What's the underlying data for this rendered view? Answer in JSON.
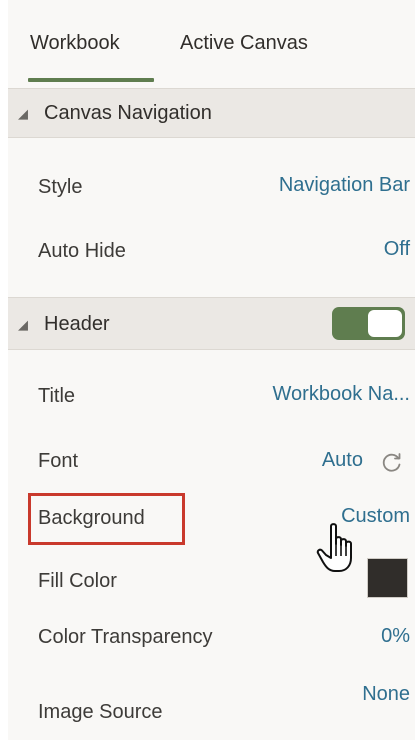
{
  "tabs": [
    {
      "label": "Workbook",
      "active": true
    },
    {
      "label": "Active Canvas",
      "active": false
    }
  ],
  "canvas_navigation": {
    "title": "Canvas Navigation",
    "rows": [
      {
        "label": "Style",
        "value": "Navigation Bar"
      },
      {
        "label": "Auto Hide",
        "value": "Off"
      }
    ]
  },
  "header_section": {
    "title": "Header",
    "toggle_on": true,
    "rows": {
      "title": {
        "label": "Title",
        "value": "Workbook Na..."
      },
      "font": {
        "label": "Font",
        "value": "Auto"
      },
      "background": {
        "label": "Background",
        "value": "Custom"
      },
      "fill_color": {
        "label": "Fill Color",
        "color": "#302d2a"
      },
      "color_transparency": {
        "label": "Color Transparency",
        "value": "0%"
      },
      "image_source": {
        "label": "Image Source",
        "value": "None"
      }
    }
  },
  "icons": {
    "refresh": "refresh-icon",
    "cursor": "hand-pointer-cursor-icon",
    "collapse": "triangle-down-icon"
  },
  "colors": {
    "accent": "#5f7d4f",
    "link": "#2f6f8f",
    "highlight": "#c9392c",
    "section_bg": "#ebe8e4",
    "panel_bg": "#f9f8f6"
  }
}
